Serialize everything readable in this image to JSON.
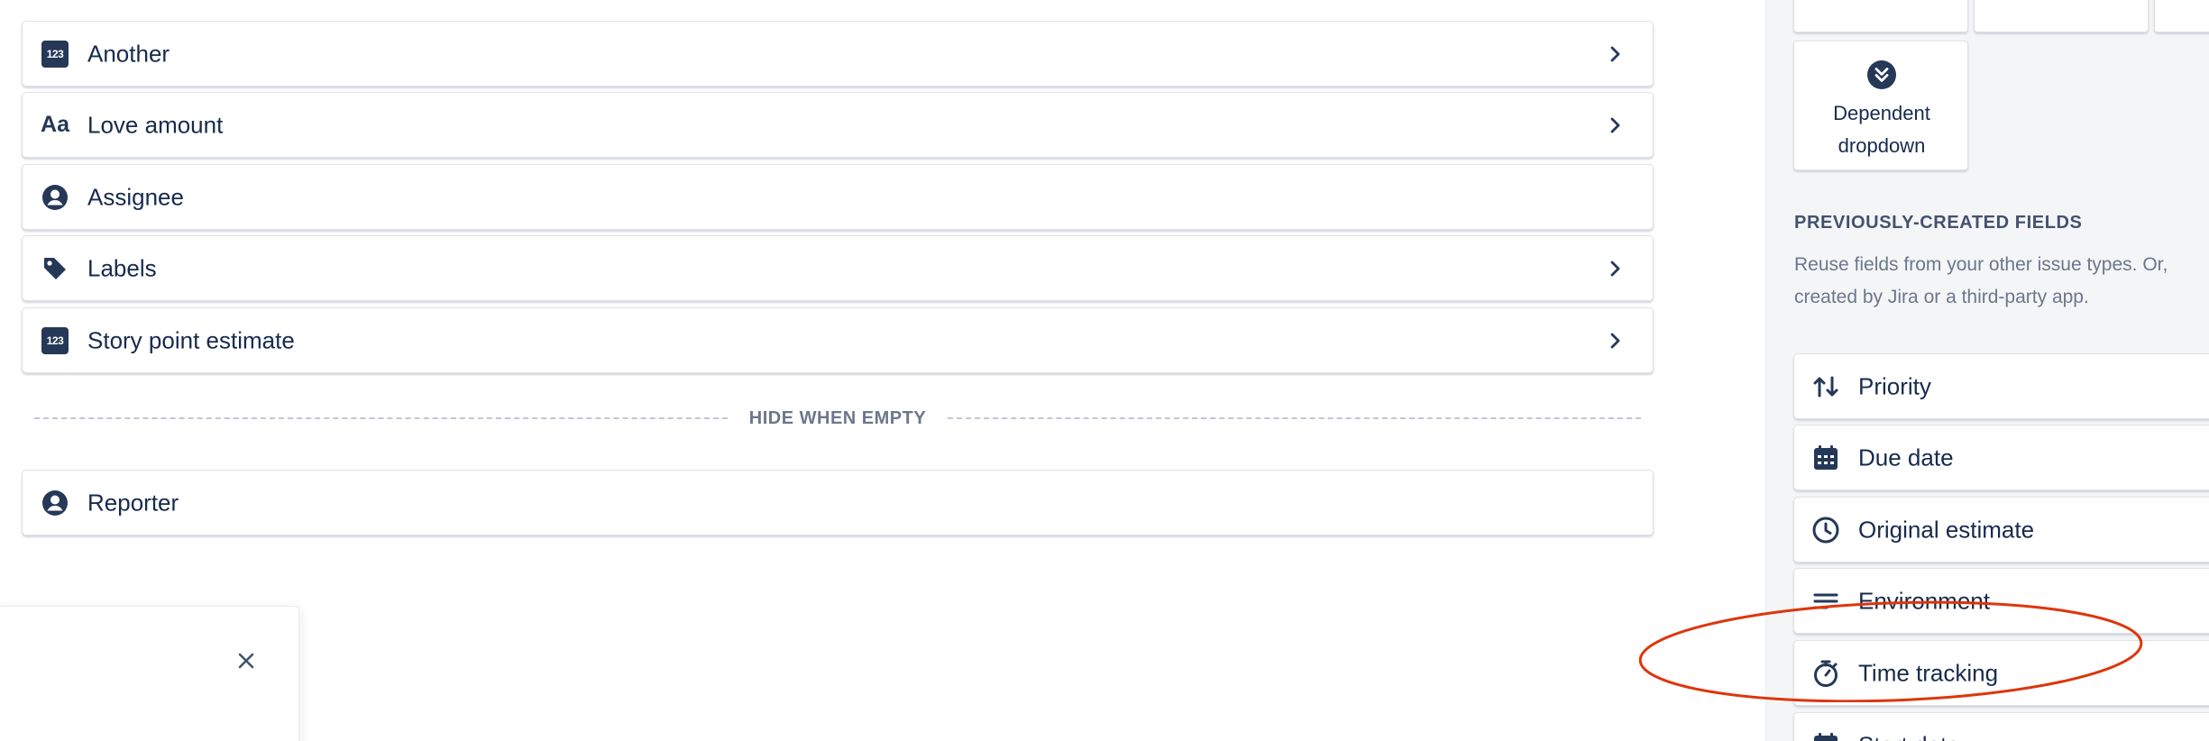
{
  "fields": [
    {
      "label": "Another",
      "icon": "number-icon",
      "badge": "123",
      "has_chevron": true
    },
    {
      "label": "Love amount",
      "icon": "text-field-icon",
      "badge": "Aa",
      "has_chevron": true
    },
    {
      "label": "Assignee",
      "icon": "person-icon",
      "badge": "",
      "has_chevron": false
    },
    {
      "label": "Labels",
      "icon": "tag-icon",
      "badge": "",
      "has_chevron": true
    },
    {
      "label": "Story point estimate",
      "icon": "number-icon",
      "badge": "123",
      "has_chevron": true
    }
  ],
  "divider_label": "HIDE WHEN EMPTY",
  "hidden_fields": [
    {
      "label": "Reporter",
      "icon": "person-icon"
    }
  ],
  "sidebar": {
    "dependent_dropdown": {
      "line1": "Dependent",
      "line2": "dropdown",
      "icon": "chevron-double-down-icon"
    },
    "section_title": "PREVIOUSLY-CREATED FIELDS",
    "section_desc": "Reuse fields from your other issue types. Or, created by Jira or a third-party app.",
    "fields": [
      {
        "label": "Priority",
        "icon": "priority-arrows-icon"
      },
      {
        "label": "Due date",
        "icon": "calendar-icon"
      },
      {
        "label": "Original estimate",
        "icon": "clock-icon"
      },
      {
        "label": "Environment",
        "icon": "text-lines-icon"
      },
      {
        "label": "Time tracking",
        "icon": "stopwatch-icon"
      },
      {
        "label": "Start date",
        "icon": "calendar-icon"
      }
    ]
  },
  "colors": {
    "text": "#172b4d",
    "icon_dark": "#253858",
    "muted": "#6b778c",
    "border": "#dfe1e6",
    "sidebar_bg": "#f4f5f7",
    "annotation": "#de350b"
  }
}
